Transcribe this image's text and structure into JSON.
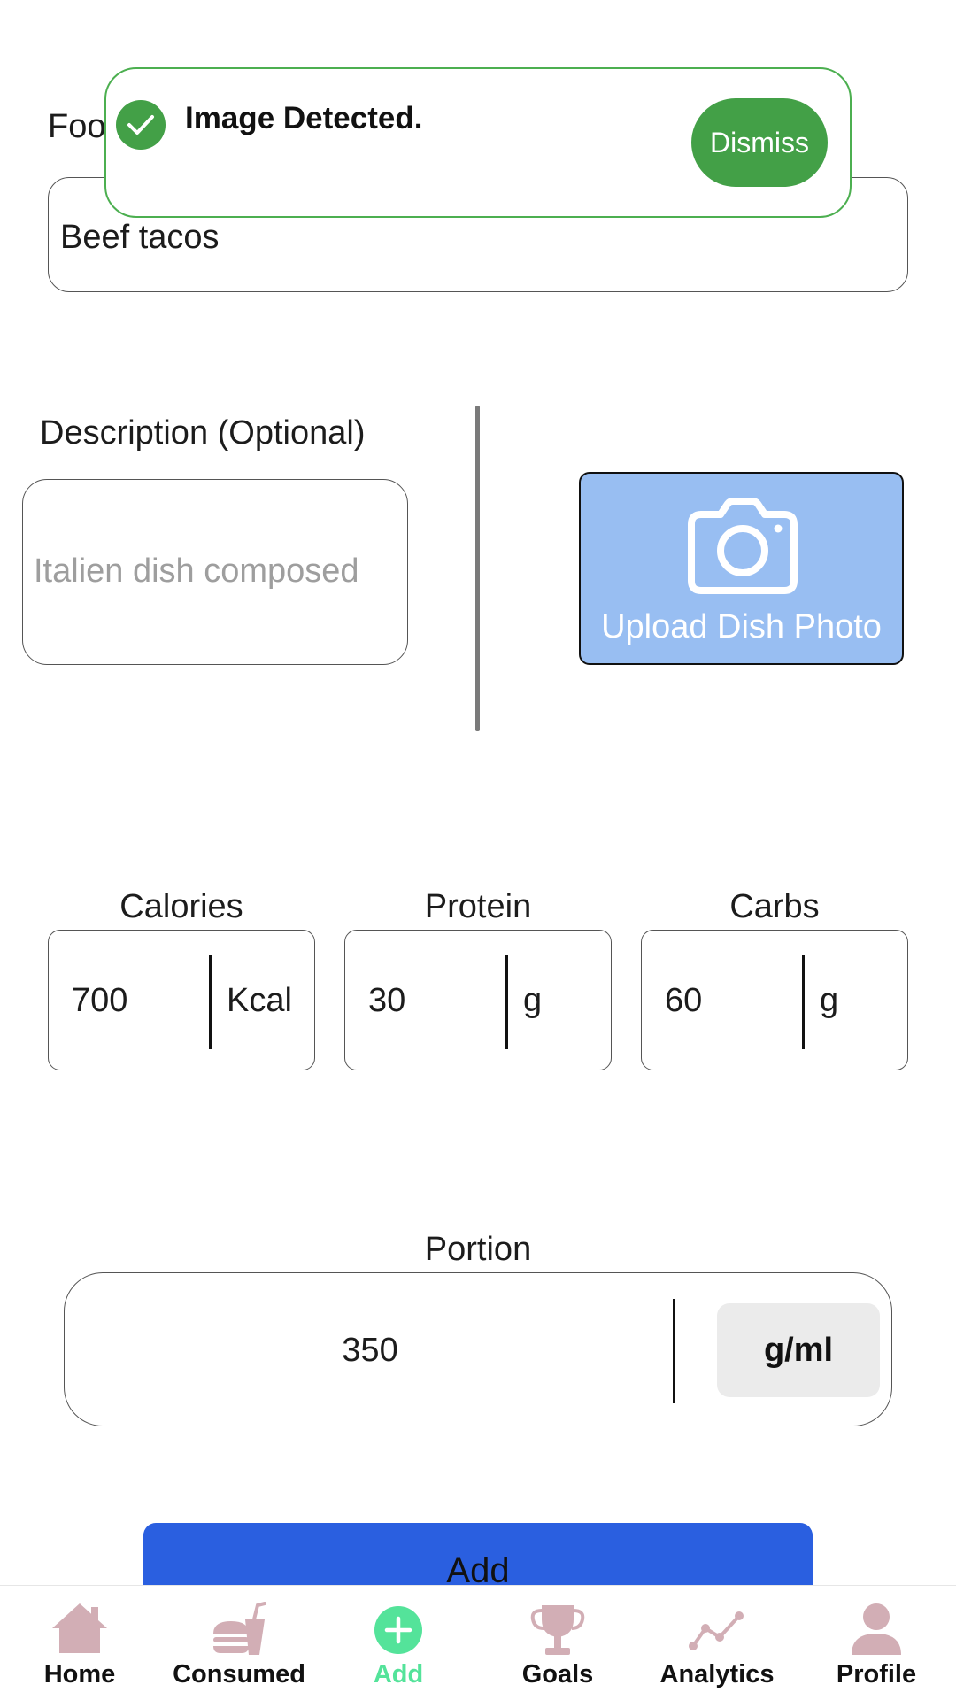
{
  "form": {
    "food_label": "Foo",
    "food_value": "Beef tacos",
    "description_label": "Description (Optional)",
    "description_placeholder": "Italien dish composed",
    "upload_label": "Upload Dish Photo"
  },
  "toast": {
    "message": "Image Detected.",
    "dismiss_label": "Dismiss",
    "icon": "check-circle-icon"
  },
  "macros": [
    {
      "label": "Calories",
      "value": "700",
      "unit": "Kcal"
    },
    {
      "label": "Protein",
      "value": "30",
      "unit": "g"
    },
    {
      "label": "Carbs",
      "value": "60",
      "unit": "g"
    }
  ],
  "portion": {
    "label": "Portion",
    "value": "350",
    "unit": "g/ml"
  },
  "add_button": {
    "label": "Add"
  },
  "nav": {
    "items": [
      {
        "label": "Home",
        "icon": "home-icon"
      },
      {
        "label": "Consumed",
        "icon": "fast-food-icon"
      },
      {
        "label": "Add",
        "icon": "plus-circle-icon",
        "active": true
      },
      {
        "label": "Goals",
        "icon": "trophy-icon"
      },
      {
        "label": "Analytics",
        "icon": "line-chart-icon"
      },
      {
        "label": "Profile",
        "icon": "person-icon"
      }
    ]
  },
  "colors": {
    "accent_green": "#43a047",
    "upload_blue": "#98bef2",
    "add_blue": "#2a5fe0",
    "nav_icon": "#d2aeb5",
    "nav_active": "#54e39a"
  }
}
